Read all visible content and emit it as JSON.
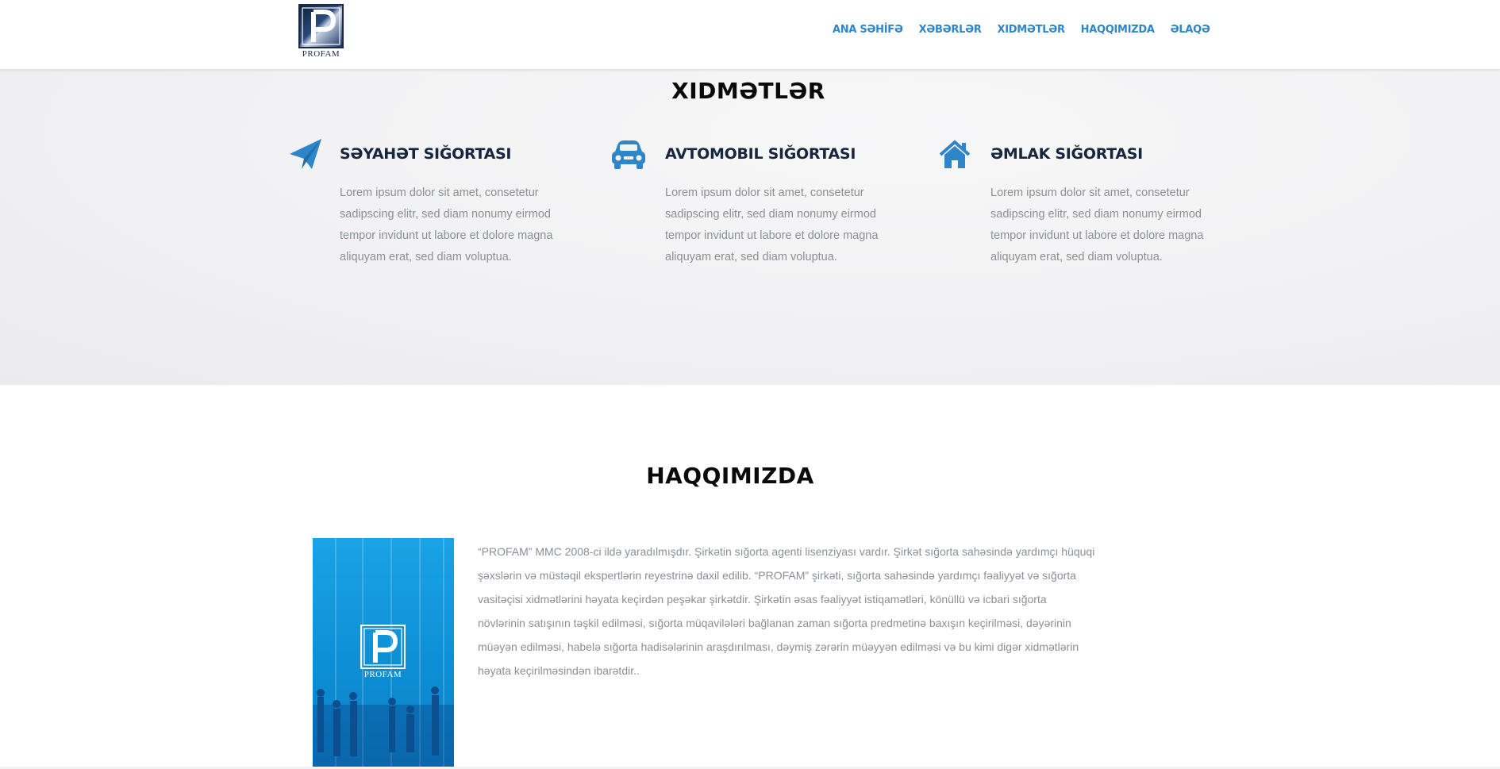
{
  "header": {
    "logo_text": "PROFAM",
    "nav": [
      "ANA SƏHİFƏ",
      "XƏBƏRLƏR",
      "XIDMƏTLƏR",
      "HAQQIMIZDA",
      "ƏLAQƏ"
    ]
  },
  "services": {
    "title": "XIDMƏTLƏR",
    "items": [
      {
        "icon": "paper-plane-icon",
        "title": "SƏYAHƏT SIĞORTASI",
        "lines": [
          "Lorem ipsum dolor sit amet, consetetur",
          "sadipscing elitr, sed diam nonumy eirmod",
          "tempor invidunt ut labore et dolore magna",
          "aliquyam erat, sed diam voluptua."
        ]
      },
      {
        "icon": "car-icon",
        "title": "AVTOMOBIL SIĞORTASI",
        "lines": [
          "Lorem ipsum dolor sit amet, consetetur",
          "sadipscing elitr, sed diam nonumy eirmod",
          "tempor invidunt ut labore et dolore magna",
          "aliquyam erat, sed diam voluptua."
        ]
      },
      {
        "icon": "home-icon",
        "title": "ƏMLAK SIĞORTASI",
        "lines": [
          "Lorem ipsum dolor sit amet, consetetur",
          "sadipscing elitr, sed diam nonumy eirmod",
          "tempor invidunt ut labore et dolore magna",
          "aliquyam erat, sed diam voluptua."
        ]
      }
    ]
  },
  "about": {
    "title": "HAQQIMIZDA",
    "image_logo_text": "PROFAM",
    "lines": [
      "“PROFAM” MMC 2008-ci ildə yaradılmışdır. Şirkətin sığorta agenti lisenziyası vardır. Şirkət sığorta sahəsində yardımçı hüquqi",
      "şəxslərin və müstəqil ekspertlərin reyestrinə daxil edilib. “PROFAM” şirkəti, sığorta sahəsində yardımçı fəaliyyət və sığorta",
      "vasitəçisi xidmətlərini həyata keçirdən peşəkar şirkətdir. Şirkətin əsas fəaliyyət istiqamətləri, könüllü və icbari sığorta",
      "növlərinin satışının təşkil edilməsi, sığorta müqavilələri bağlanan zaman sığorta predmetinə baxışın keçirilməsi, dəyərinin",
      "müəyən edilməsi, habelə sığorta hadisələrinin araşdırılması, dəymiş zərərin müəyyən edilməsi və bu kimi digər xidmətlərin",
      "həyata keçirilməsindən ibarətdir.."
    ]
  },
  "colors": {
    "accent": "#2e86c8",
    "heading": "#16263d",
    "body_text": "#8a8f96",
    "image_blue": "#0d8fd6"
  }
}
